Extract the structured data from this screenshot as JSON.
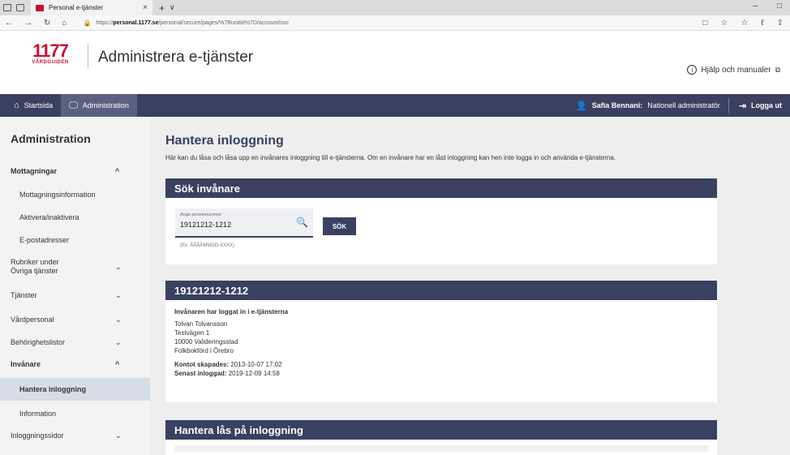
{
  "browser": {
    "tab_title": "Personal e-tjänster",
    "tab_close": "×",
    "new_tab": "+",
    "tab_dropdown": "∨",
    "url_prefix": "https://",
    "url_host": "personal.1177.se",
    "url_path": "/personal/secure/pages/%7Bunitid%7D/account/soc",
    "win_minimize": "–",
    "win_maximize": "□",
    "nav_back": "←",
    "nav_forward": "→",
    "nav_refresh": "↻",
    "nav_home": "⌂",
    "lock_glyph": "🔒",
    "addr_right": [
      "□",
      "☆",
      "☆",
      "ℓ",
      "⇪"
    ]
  },
  "header": {
    "logo_number": "1177",
    "logo_text": "VÅRDGUIDEN",
    "app_title": "Administrera e-tjänster",
    "help_icon": "i",
    "help_label": "Hjälp och manualer",
    "help_ext": "⧉"
  },
  "topnav": {
    "home_icon": "⌂",
    "home_label": "Startsida",
    "admin_icon": "🖵",
    "admin_label": "Administration",
    "user_icon": "👤",
    "user_name": "Safia Bennani:",
    "user_role": "Nationell administratör",
    "logout_icon": "⇥",
    "logout_label": "Logga ut"
  },
  "sidebar": {
    "title": "Administration",
    "items": [
      {
        "label": "Mottagningar",
        "chev": "^"
      },
      {
        "label": "Mottagningsinformation"
      },
      {
        "label": "Aktivera/inaktivera"
      },
      {
        "label": "E-postadresser"
      },
      {
        "label": "Rubriker under",
        "label2": "Övriga tjänster",
        "chev": "⌄"
      },
      {
        "label": "Tjänster",
        "chev": "⌄"
      },
      {
        "label": "Vårdpersonal",
        "chev": "⌄"
      },
      {
        "label": "Behörighetslistor",
        "chev": "⌄"
      },
      {
        "label": "Invånare",
        "chev": "^"
      },
      {
        "label": "Hantera inloggning"
      },
      {
        "label": "Information"
      },
      {
        "label": "Inloggningssidor",
        "chev": "⌄"
      }
    ]
  },
  "main": {
    "title": "Hantera inloggning",
    "description": "Här kan du låsa och låsa upp en invånares inloggning till e-tjänsterna. Om en invånare har en låst inloggning kan hen inte logga in och använda e-tjänsterna.",
    "search_card": {
      "heading": "Sök invånare",
      "field_label": "Ange personnummer",
      "field_value": "19121212-1212",
      "search_icon": "🔍",
      "hint": "(Ex. ÅÅÅÅMMDD-XXXX)",
      "button": "SÖK"
    },
    "person_card": {
      "heading": "19121212-1212",
      "status": "Invånaren har loggat in i e-tjänsterna",
      "name": "Tolvan Tolvansson",
      "street": "Testvägen 1",
      "postal": "10000 Valideringsstad",
      "registered": "Folkbokförd i Örebro",
      "created_label": "Kontot skapades:",
      "created_value": "2013-10-07 17:02",
      "last_login_label": "Senast inloggad:",
      "last_login_value": "2019-12-09 14:58"
    },
    "lock_card": {
      "heading": "Hantera lås på inloggning"
    }
  }
}
